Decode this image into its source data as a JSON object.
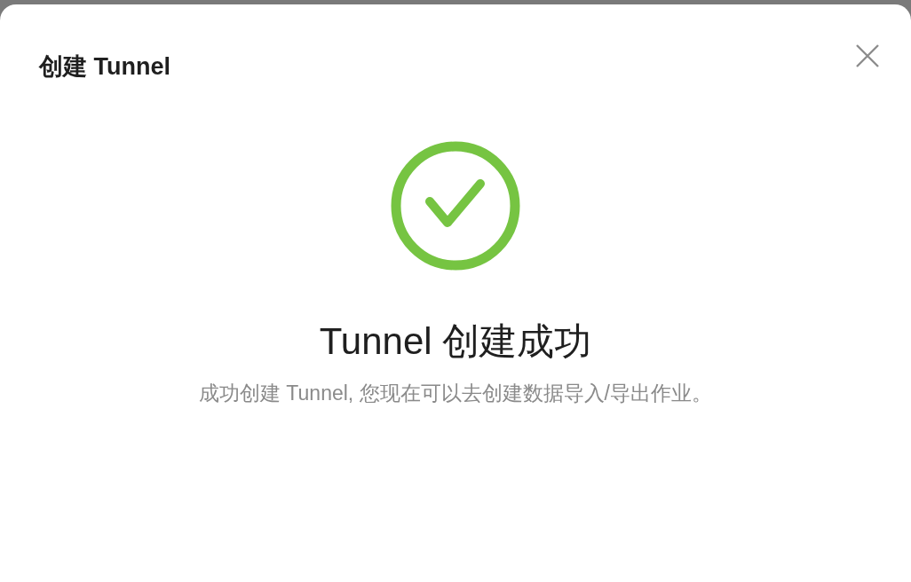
{
  "dialog": {
    "title": "创建 Tunnel"
  },
  "result": {
    "kind": "success",
    "heading": "Tunnel 创建成功",
    "message": "成功创建 Tunnel, 您现在可以去创建数据导入/导出作业。"
  }
}
